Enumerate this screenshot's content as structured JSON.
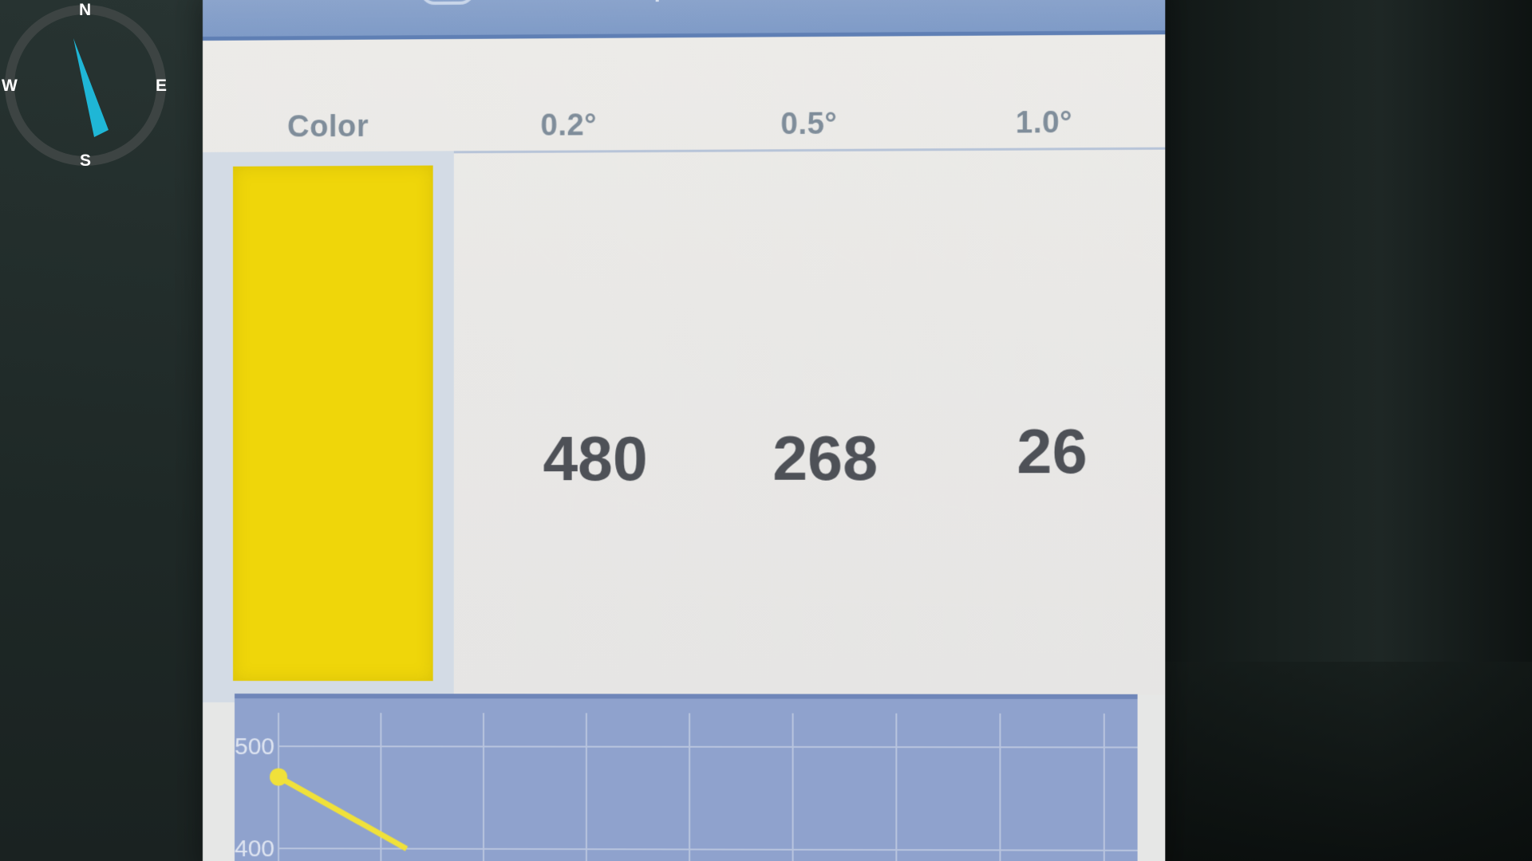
{
  "compass": {
    "north": "N",
    "south": "S",
    "east": "E",
    "west": "W",
    "needle_color": "#1fb6d6"
  },
  "table": {
    "headers": [
      "Color",
      "0.2°",
      "0.5°",
      "1.0°"
    ],
    "row": {
      "swatch_color": "#efd60a",
      "values": [
        "480",
        "268",
        "26"
      ]
    }
  },
  "chart_data": {
    "type": "line",
    "y_tick_labels": [
      "500",
      "400"
    ],
    "series": [
      {
        "points": [
          [
            0,
            470
          ],
          [
            1,
            400
          ]
        ],
        "color": "#f0e13a"
      }
    ],
    "grid": true
  }
}
